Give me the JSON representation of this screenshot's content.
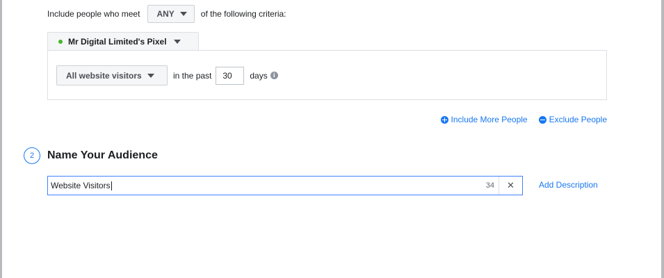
{
  "criteria_row": {
    "prefix": "Include people who meet",
    "match_value": "ANY",
    "suffix": "of the following criteria:"
  },
  "pixel_tab": {
    "label": "Mr Digital Limited's Pixel",
    "status_color": "#42b72a"
  },
  "criteria": {
    "event_select": "All website visitors",
    "in_the_past": "in the past",
    "days_value": "30",
    "days_label": "days",
    "info_glyph": "i"
  },
  "people_actions": {
    "include_label": "Include More People",
    "exclude_label": "Exclude People"
  },
  "step": {
    "number": "2",
    "title": "Name Your Audience"
  },
  "audience_name": {
    "value": "Website Visitors",
    "char_count": "34",
    "clear_glyph": "✕"
  },
  "add_description_label": "Add Description",
  "colors": {
    "accent": "#1877f2",
    "focus_border": "#4080ff"
  }
}
